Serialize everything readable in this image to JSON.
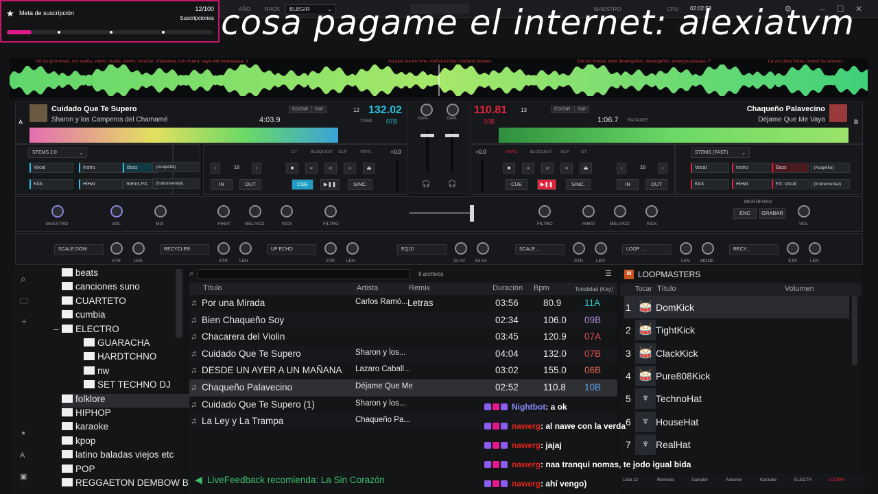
{
  "topbar": {
    "deck_sel": "ELEGIR",
    "rack_label": "RACK",
    "maestro_label": "MAESTRO",
    "cpu_label": "CPU",
    "clock": "02:02:58",
    "mode_label": "AÑO"
  },
  "subgoal": {
    "title": "Meta de suscripción",
    "count": "12/100",
    "label": "Suscripciones",
    "progress": 0.12
  },
  "overlay_text": "cosa pagame el internet: alexiatvm",
  "lyrics": [
    "No tus promesas, voz suelta, viento. suelta, viento. corazón, chacarera, con muera. vaya ella mueraaaaa. d",
    "Aunque tan en irme. mañana triste. mañana tristeee.",
    "Del tus manos, bebí desengaños, desengañós, amarguuuraaaas. F",
    "La vos diste flores, rencor tus amores"
  ],
  "deck_a": {
    "letter": "A",
    "title": "Cuidado Que Te Supero",
    "artist": "Sharon y los Camperos del Chamamé",
    "time": "4:03.9",
    "bpm": "132.02",
    "key": "07B",
    "pitch": "12",
    "tono": "TONO",
    "edit": "EDITAR",
    "tap": "TAP",
    "master": "MAESTRO",
    "sync": "SINC."
  },
  "deck_b": {
    "letter": "B",
    "title": "Chaqueño Palavecino",
    "artist": "Déjame Que Me Vaya",
    "time": "1:06.7",
    "bpm": "110.81",
    "key": "10B",
    "pitch": "13",
    "tono": "TONO",
    "edit": "EDITAR",
    "tap": "TAP",
    "remaining": "FALTANTE",
    "master": "MAESTRO",
    "sync": "SINC."
  },
  "stems_a": {
    "mode": "STEMS 2.0",
    "items": [
      "Vocal",
      "Instru",
      "Bass",
      "(Acapella)",
      "Kick",
      "HiHat",
      "Stems FX",
      "(Instrumental)"
    ]
  },
  "stems_b": {
    "mode": "STEMS (FAST)",
    "items": [
      "Vocal",
      "Instru",
      "Bass",
      "(Acapella)",
      "Kick",
      "HiHat",
      "FX: Vocal",
      "(Instrumental)"
    ]
  },
  "transport": {
    "loop": "16",
    "in": "IN",
    "out": "OUT",
    "cue": "CUE",
    "sync": "SINC.",
    "pitch": "+0.0",
    "gt": "GT",
    "slip": "SLIP",
    "vinyl": "VINYL",
    "bloqueo": "BLOQUEAT",
    "gan": "GAN."
  },
  "fx": {
    "a": [
      "SCALE DOW",
      "RECYCLER",
      "UP ECHO"
    ],
    "b": [
      "SCALE ...",
      "LOOP ...",
      "RECY..."
    ],
    "center": "EQ10",
    "knob_labels": [
      "STR",
      "LEN",
      "STR",
      "LEN",
      "STR",
      "LEN",
      "32 Hz",
      "63 Hz",
      "STR",
      "LEN",
      "LEN",
      "MODE",
      "STR",
      "LEN"
    ]
  },
  "eq_labels": {
    "a": [
      "MAESTRO",
      "VOL",
      "MIX",
      "HIHAT",
      "MEL/VOZ",
      "KICK",
      "FILTRO"
    ],
    "b": [
      "FILTRO",
      "HIHAT",
      "MEL/VOZ",
      "KICK",
      "ENC",
      "GRABAR",
      "VOL"
    ],
    "mic": "MICRÓFONO"
  },
  "tree": {
    "folders": [
      {
        "name": "beats",
        "indent": 0
      },
      {
        "name": "canciones suno",
        "indent": 0
      },
      {
        "name": "CUARTETO",
        "indent": 0
      },
      {
        "name": "cumbia",
        "indent": 0
      },
      {
        "name": "ELECTRO",
        "indent": 0,
        "open": true
      },
      {
        "name": "GUARACHA",
        "indent": 1
      },
      {
        "name": "HARDTCHNO",
        "indent": 1
      },
      {
        "name": "nw",
        "indent": 1
      },
      {
        "name": "SET TECHNO DJ",
        "indent": 1
      },
      {
        "name": "folklore",
        "indent": 0,
        "selected": true
      },
      {
        "name": "HIPHOP",
        "indent": 0
      },
      {
        "name": "karaoke",
        "indent": 0
      },
      {
        "name": "kpop",
        "indent": 0
      },
      {
        "name": "latino baladas viejos etc",
        "indent": 0
      },
      {
        "name": "POP",
        "indent": 0
      },
      {
        "name": "REGGAETON DEMBOW BR",
        "indent": 0
      }
    ]
  },
  "browser": {
    "count": "8 archivos",
    "columns": [
      "Título",
      "Artista",
      "Remix",
      "Duración",
      "Bpm",
      "Tonalidad (Key)"
    ],
    "rows": [
      {
        "title": "Por una Mirada",
        "artist": "Carlos Ramó...",
        "remix": "Letras",
        "dur": "03:56",
        "bpm": "80.9",
        "key": "11A",
        "keycolor": "#35c9c9"
      },
      {
        "title": "Bien Chaqueño Soy",
        "artist": "",
        "remix": "",
        "dur": "02:34",
        "bpm": "106.0",
        "key": "09B",
        "keycolor": "#a98bd8"
      },
      {
        "title": "Chacarera del Violin",
        "artist": "",
        "remix": "",
        "dur": "03:45",
        "bpm": "120.9",
        "key": "07A",
        "keycolor": "#e0524f"
      },
      {
        "title": "Cuidado Que Te Supero",
        "artist": "Sharon y los...",
        "remix": "",
        "dur": "04:04",
        "bpm": "132.0",
        "key": "07B",
        "keycolor": "#e0524f"
      },
      {
        "title": "DESDE UN AYER A UN MAÑANA",
        "artist": "Lazaro Caball...",
        "remix": "",
        "dur": "03:02",
        "bpm": "155.0",
        "key": "06B",
        "keycolor": "#e06a4f"
      },
      {
        "title": "Chaqueño Palavecino",
        "artist": "Déjame Que Me",
        "remix": "",
        "dur": "02:52",
        "bpm": "110.8",
        "key": "10B",
        "keycolor": "#5aa0e8"
      },
      {
        "title": "Cuidado Que Te Supero (1)",
        "artist": "Sharon y los...",
        "remix": "",
        "dur": "",
        "bpm": "",
        "key": "",
        "keycolor": "#ffffff"
      },
      {
        "title": "La Ley y La Trampa",
        "artist": "Chaqueño Pa...",
        "remix": "",
        "dur": "",
        "bpm": "",
        "key": "",
        "keycolor": "#ffffff"
      }
    ],
    "livefeedback": "LiveFeedback recomienda: La Sin Corazón"
  },
  "loop": {
    "header": "LOOPMASTERS",
    "cols": [
      "Tocar",
      "Título",
      "Volumen"
    ],
    "items": [
      {
        "n": "1",
        "name": "DomKick"
      },
      {
        "n": "2",
        "name": "TightKick"
      },
      {
        "n": "3",
        "name": "ClackKick"
      },
      {
        "n": "4",
        "name": "Pure808Kick"
      },
      {
        "n": "5",
        "name": "TechnoHat"
      },
      {
        "n": "6",
        "name": "HouseHat"
      },
      {
        "n": "7",
        "name": "RealHat"
      }
    ]
  },
  "bottom_tabs": [
    "Lista Cr",
    "Remixes",
    "Sampler",
    "Automix",
    "Karaoke",
    "ELECTR",
    "LOOPM"
  ],
  "chat": [
    {
      "user": "Nightbot",
      "msg": ": a ok",
      "usercolor": "#8c8cff"
    },
    {
      "user": "nawerg",
      "msg": ": al nawe con la verda",
      "usercolor": "#e0241b"
    },
    {
      "user": "nawerg",
      "msg": ": jajaj",
      "usercolor": "#e0241b"
    },
    {
      "user": "nawerg",
      "msg": ": naa tranqui nomas, te jodo igual bida",
      "usercolor": "#e0241b"
    },
    {
      "user": "nawerg",
      "msg": ": ahí vengo)",
      "usercolor": "#e0241b"
    }
  ],
  "colors": {
    "accent_cyan": "#27c3e0",
    "accent_red": "#e3243b",
    "deck_a_bpm": "#27c3e0",
    "deck_b_bpm": "#e3243b",
    "sub_pink": "#e3188a"
  }
}
